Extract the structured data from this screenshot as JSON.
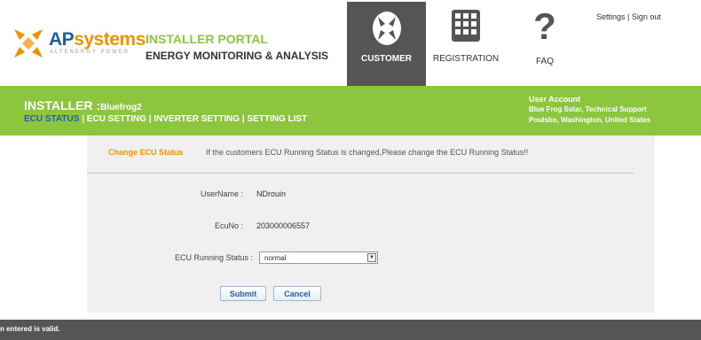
{
  "brand": {
    "logo_main": "AP",
    "logo_accent": "systems",
    "logo_tagline": "ALTENERGY POWER",
    "portal_title": "INSTALLER PORTAL",
    "portal_subtitle": "ENERGY MONITORING & ANALYSIS"
  },
  "nav": {
    "customer_label": "CUSTOMER",
    "registration_label": "REGISTRATION",
    "faq_label": "FAQ",
    "faq_glyph": "?"
  },
  "toplinks": {
    "settings": "Settings",
    "separator": " | ",
    "signout": "Sign out"
  },
  "installer": {
    "prefix": "INSTALLER :",
    "name": "Bluefrog2"
  },
  "menu": {
    "items": [
      "ECU STATUS",
      "ECU SETTING",
      "INVERTER SETTING",
      "SETTING LIST"
    ],
    "separator": " | "
  },
  "account": {
    "title": "User Account",
    "line1": "Blue Frog Solar, Technical Support",
    "line2": "Poulsbo, Washington, United States"
  },
  "form": {
    "section_label": "Change ECU Status",
    "note": "If the customers ECU Running Status is changed,Please change the ECU Running Status!!",
    "username_label": "UserName :",
    "username_value": "NDrouin",
    "ecuno_label": "EcuNo :",
    "ecuno_value": "203000006557",
    "status_label": "ECU Running Status :",
    "status_value": "normal",
    "submit_label": "Submit",
    "cancel_label": "Cancel"
  },
  "status_bar": {
    "text": "n entered is valid."
  },
  "colors": {
    "green": "#8cc63f",
    "orange": "#f29100",
    "blue": "#1b5fa0",
    "dark_gray": "#555555"
  }
}
